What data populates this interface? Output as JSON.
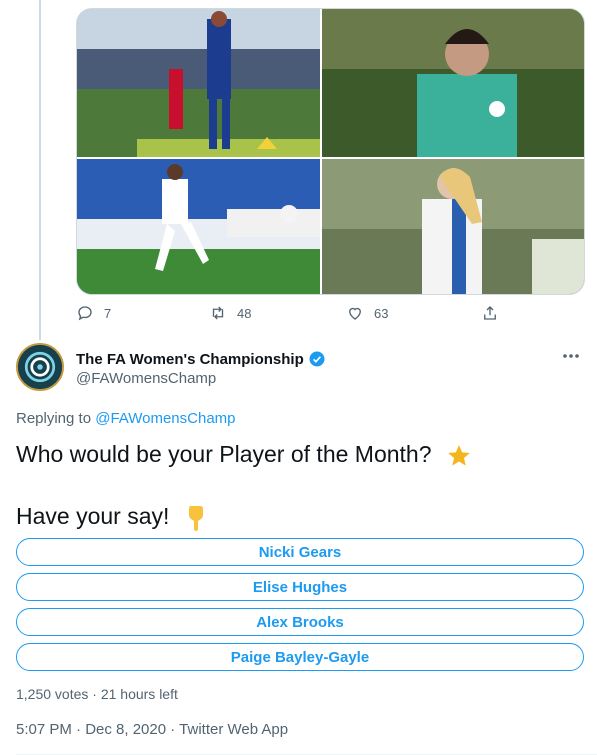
{
  "colors": {
    "accent": "#1d9bf0",
    "muted_text": "#536471",
    "border": "#cfd9de"
  },
  "previous_tweet": {
    "media": [
      {
        "icon": "player-photo-blue-kit"
      },
      {
        "icon": "goalkeeper-photo-green-kit"
      },
      {
        "icon": "player-photo-white-kit"
      },
      {
        "icon": "player-photo-blackburn-kit"
      }
    ],
    "actions": {
      "reply_count": "7",
      "retweet_count": "48",
      "like_count": "63"
    }
  },
  "tweet": {
    "author": {
      "name": "The FA Women's Championship",
      "handle": "@FAWomensChamp",
      "verified": true
    },
    "replying_prefix": "Replying to",
    "replying_handle": "@FAWomensChamp",
    "text_line1": "Who would be your Player of the Month?",
    "text_line1_emoji": "star-emoji",
    "text_line2": "Have your say!",
    "text_line2_emoji": "pointing-down-emoji",
    "poll": {
      "options": [
        "Nicki Gears",
        "Elise Hughes",
        "Alex Brooks",
        "Paige Bayley-Gayle"
      ],
      "meta": "1,250 votes · 21 hours left"
    },
    "timestamp": "5:07 PM · Dec 8, 2020",
    "source": "Twitter Web App"
  }
}
